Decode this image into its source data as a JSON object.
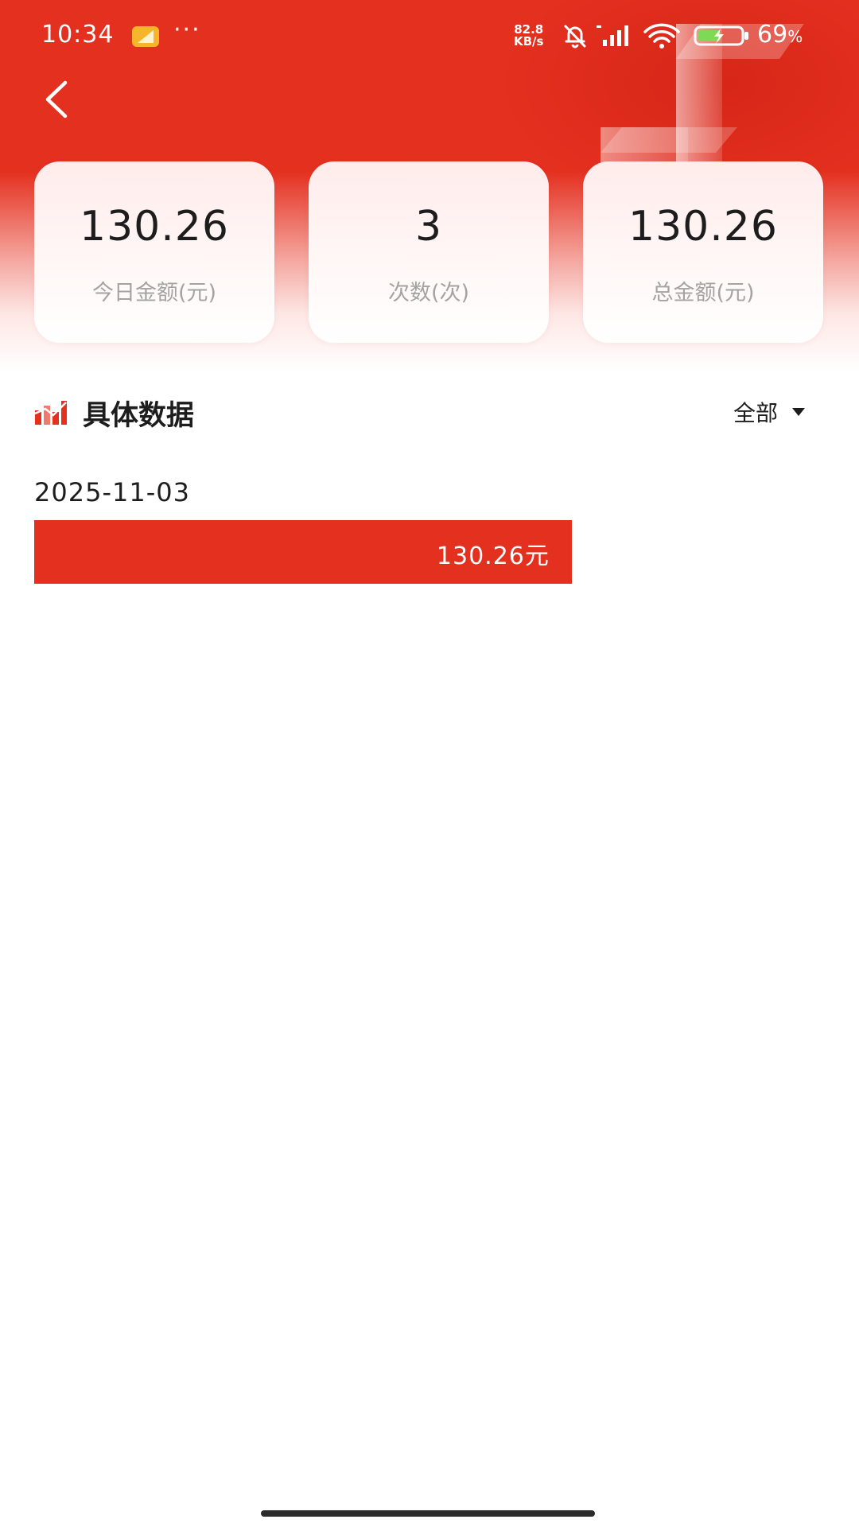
{
  "status_bar": {
    "time": "10:34",
    "more": "···",
    "net_speed_value": "82.8",
    "net_speed_unit": "KB/s",
    "battery_percent": "69",
    "battery_unit": "%"
  },
  "stats": [
    {
      "value": "130.26",
      "label": "今日金额(元)"
    },
    {
      "value": "3",
      "label": "次数(次)"
    },
    {
      "value": "130.26",
      "label": "总金额(元)"
    }
  ],
  "section": {
    "title": "具体数据",
    "filter_label": "全部"
  },
  "rows": [
    {
      "date": "2025-11-03",
      "value_label": "130.26元",
      "fill_fraction": 0.68
    }
  ],
  "colors": {
    "accent": "#e4301f",
    "label_gray": "#a3a3a3"
  },
  "icons": [
    "back-icon",
    "chart-bars-icon",
    "caret-down-icon",
    "mute-bell-icon",
    "signal-icon",
    "wifi-icon",
    "battery-icon"
  ]
}
